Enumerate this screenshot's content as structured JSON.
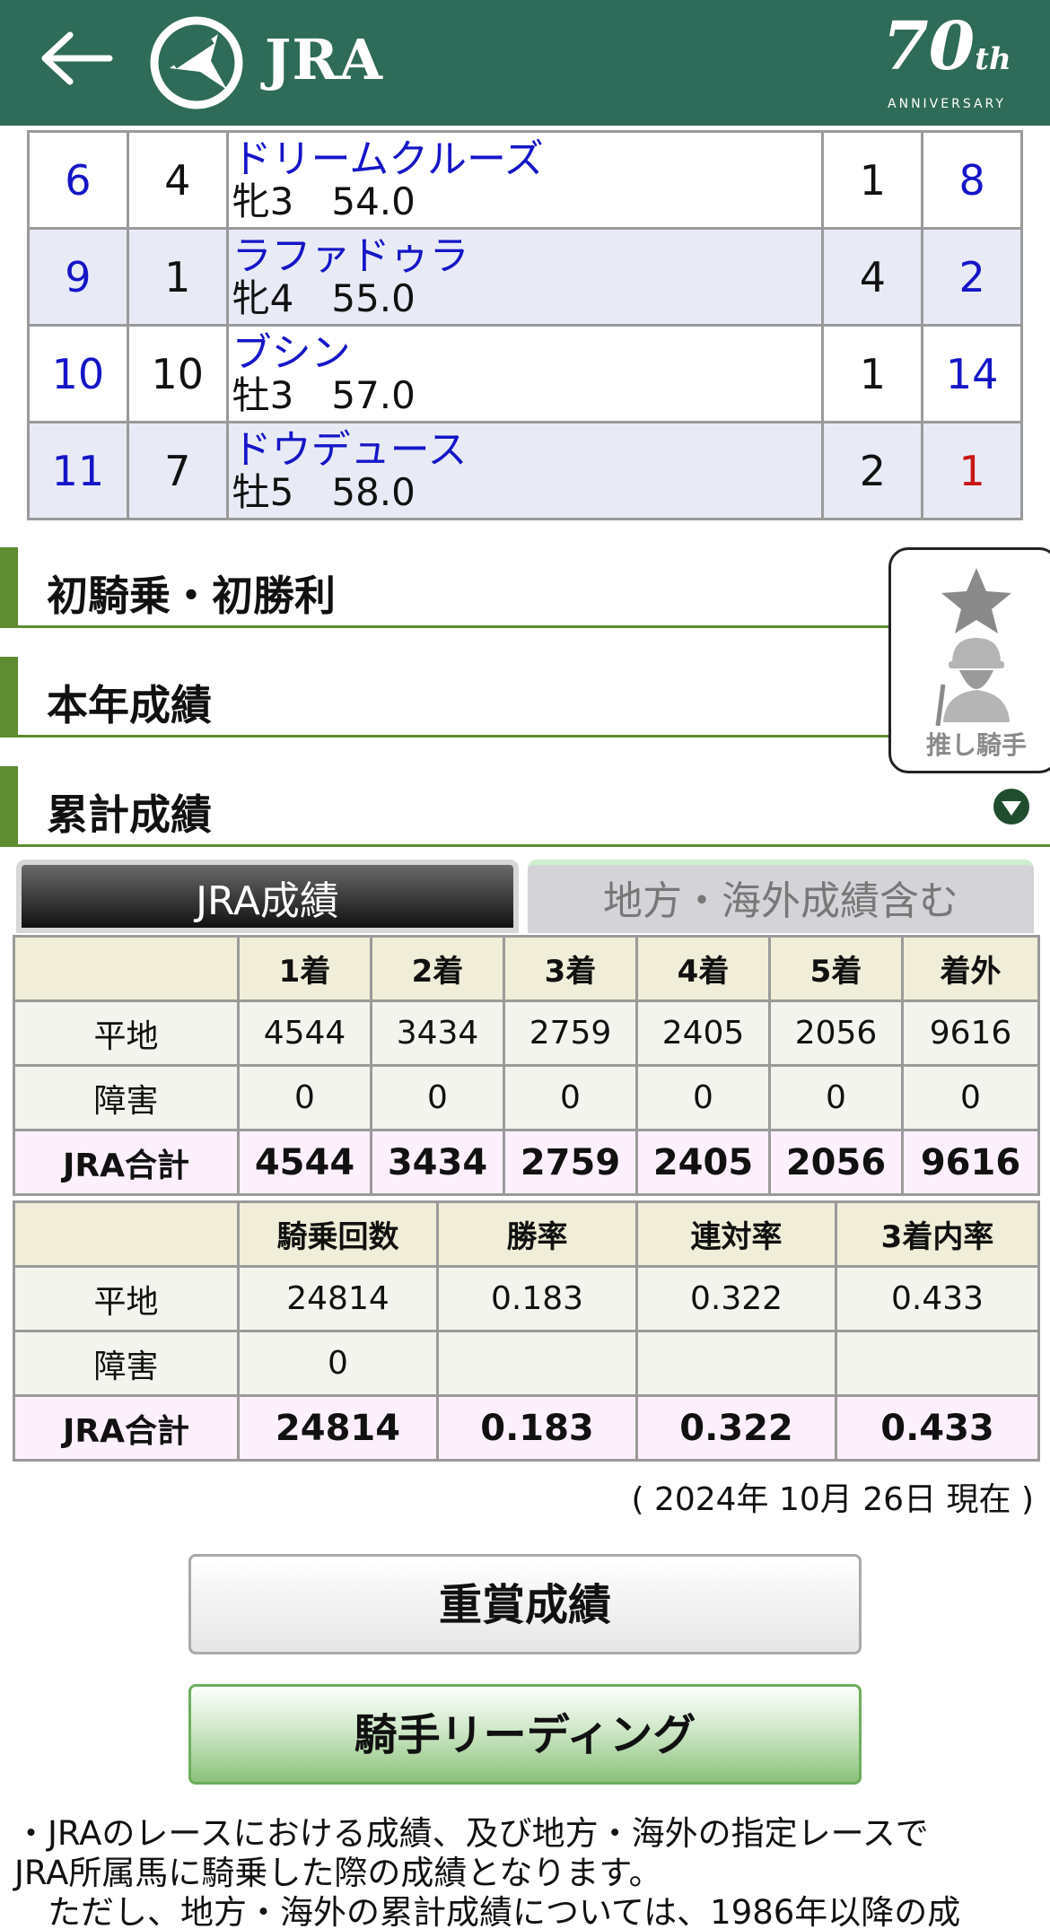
{
  "header": {
    "logo_text": "JRA",
    "anniversary_number": "70",
    "anniversary_suffix": "th",
    "anniversary_label": "ANNIVERSARY"
  },
  "horses": [
    {
      "col1": "6",
      "col2": "4",
      "name": "ドリームクルーズ",
      "info": "牝3　54.0",
      "col4": "1",
      "col5": "8",
      "col5_color": "blue"
    },
    {
      "col1": "9",
      "col2": "1",
      "name": "ラファドゥラ",
      "info": "牝4　55.0",
      "col4": "4",
      "col5": "2",
      "col5_color": "blue"
    },
    {
      "col1": "10",
      "col2": "10",
      "name": "ブシン",
      "info": "牡3　57.0",
      "col4": "1",
      "col5": "14",
      "col5_color": "blue"
    },
    {
      "col1": "11",
      "col2": "7",
      "name": "ドウデュース",
      "info": "牡5　58.0",
      "col4": "2",
      "col5": "1",
      "col5_color": "red"
    }
  ],
  "sections": {
    "first_ride": "初騎乗・初勝利",
    "this_year": "本年成績",
    "cumulative": "累計成績"
  },
  "favorite": {
    "label": "推し騎手"
  },
  "tabs": {
    "jra": "JRA成績",
    "incl_local": "地方・海外成績含む"
  },
  "placings": {
    "headers": [
      "1着",
      "2着",
      "3着",
      "4着",
      "5着",
      "着外"
    ],
    "rows": [
      {
        "label": "平地",
        "values": [
          "4544",
          "3434",
          "2759",
          "2405",
          "2056",
          "9616"
        ]
      },
      {
        "label": "障害",
        "values": [
          "0",
          "0",
          "0",
          "0",
          "0",
          "0"
        ]
      },
      {
        "label": "JRA合計",
        "values": [
          "4544",
          "3434",
          "2759",
          "2405",
          "2056",
          "9616"
        ]
      }
    ]
  },
  "rates": {
    "headers": [
      "騎乗回数",
      "勝率",
      "連対率",
      "3着内率"
    ],
    "rows": [
      {
        "label": "平地",
        "values": [
          "24814",
          "0.183",
          "0.322",
          "0.433"
        ]
      },
      {
        "label": "障害",
        "values": [
          "0",
          "",
          "",
          ""
        ]
      },
      {
        "label": "JRA合計",
        "values": [
          "24814",
          "0.183",
          "0.322",
          "0.433"
        ]
      }
    ]
  },
  "as_of": "( 2024年 10月 26日 現在 )",
  "buttons": {
    "grade_results": "重賞成績",
    "jockey_leading": "騎手リーディング"
  },
  "notes": {
    "line1": "・JRAのレースにおける成績、及び地方・海外の指定レースで",
    "line2": "JRA所属馬に騎乗した際の成績となります。",
    "line3": "ただし、地方・海外の累計成績については、1986年以降の成"
  },
  "colors": {
    "header_bg": "#2e6b58",
    "section_accent": "#5e8c31",
    "link_blue": "#1515c8",
    "highlight_red": "#c81515"
  }
}
